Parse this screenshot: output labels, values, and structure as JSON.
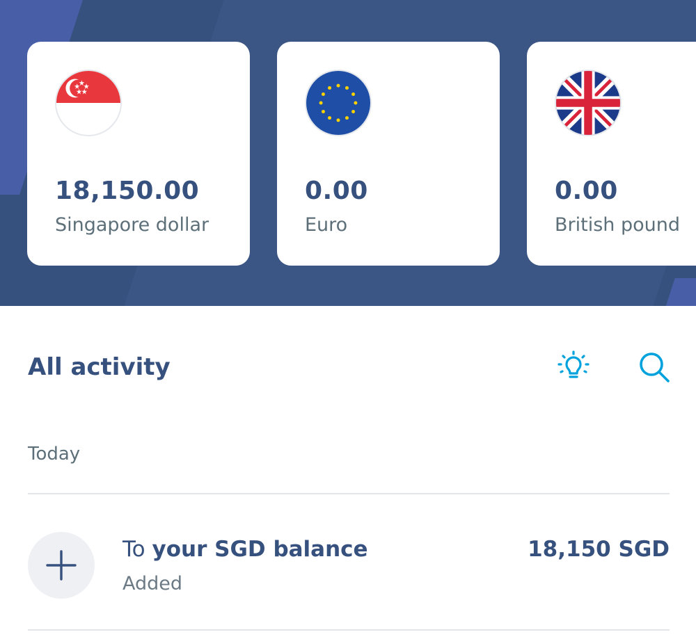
{
  "balances": [
    {
      "currency_code": "SGD",
      "flag_icon": "singapore-flag-icon",
      "amount": "18,150.00",
      "name": "Singapore dollar"
    },
    {
      "currency_code": "EUR",
      "flag_icon": "eu-flag-icon",
      "amount": "0.00",
      "name": "Euro"
    },
    {
      "currency_code": "GBP",
      "flag_icon": "uk-flag-icon",
      "amount": "0.00",
      "name": "British pound"
    }
  ],
  "activity": {
    "title": "All activity",
    "icons": {
      "insights": "lightbulb-icon",
      "search": "search-icon"
    },
    "group_label": "Today",
    "transactions": [
      {
        "icon": "plus-icon",
        "title_prefix": "To ",
        "title_strong": "your SGD balance",
        "status": "Added",
        "amount": "18,150 SGD"
      }
    ]
  },
  "colors": {
    "navy": "#37517e",
    "hero_background": "#37517e",
    "hero_stripe": "#485fa7",
    "accent_blue": "#00a2dd",
    "muted_text": "#5d7079",
    "divider": "#e2e6e8"
  }
}
